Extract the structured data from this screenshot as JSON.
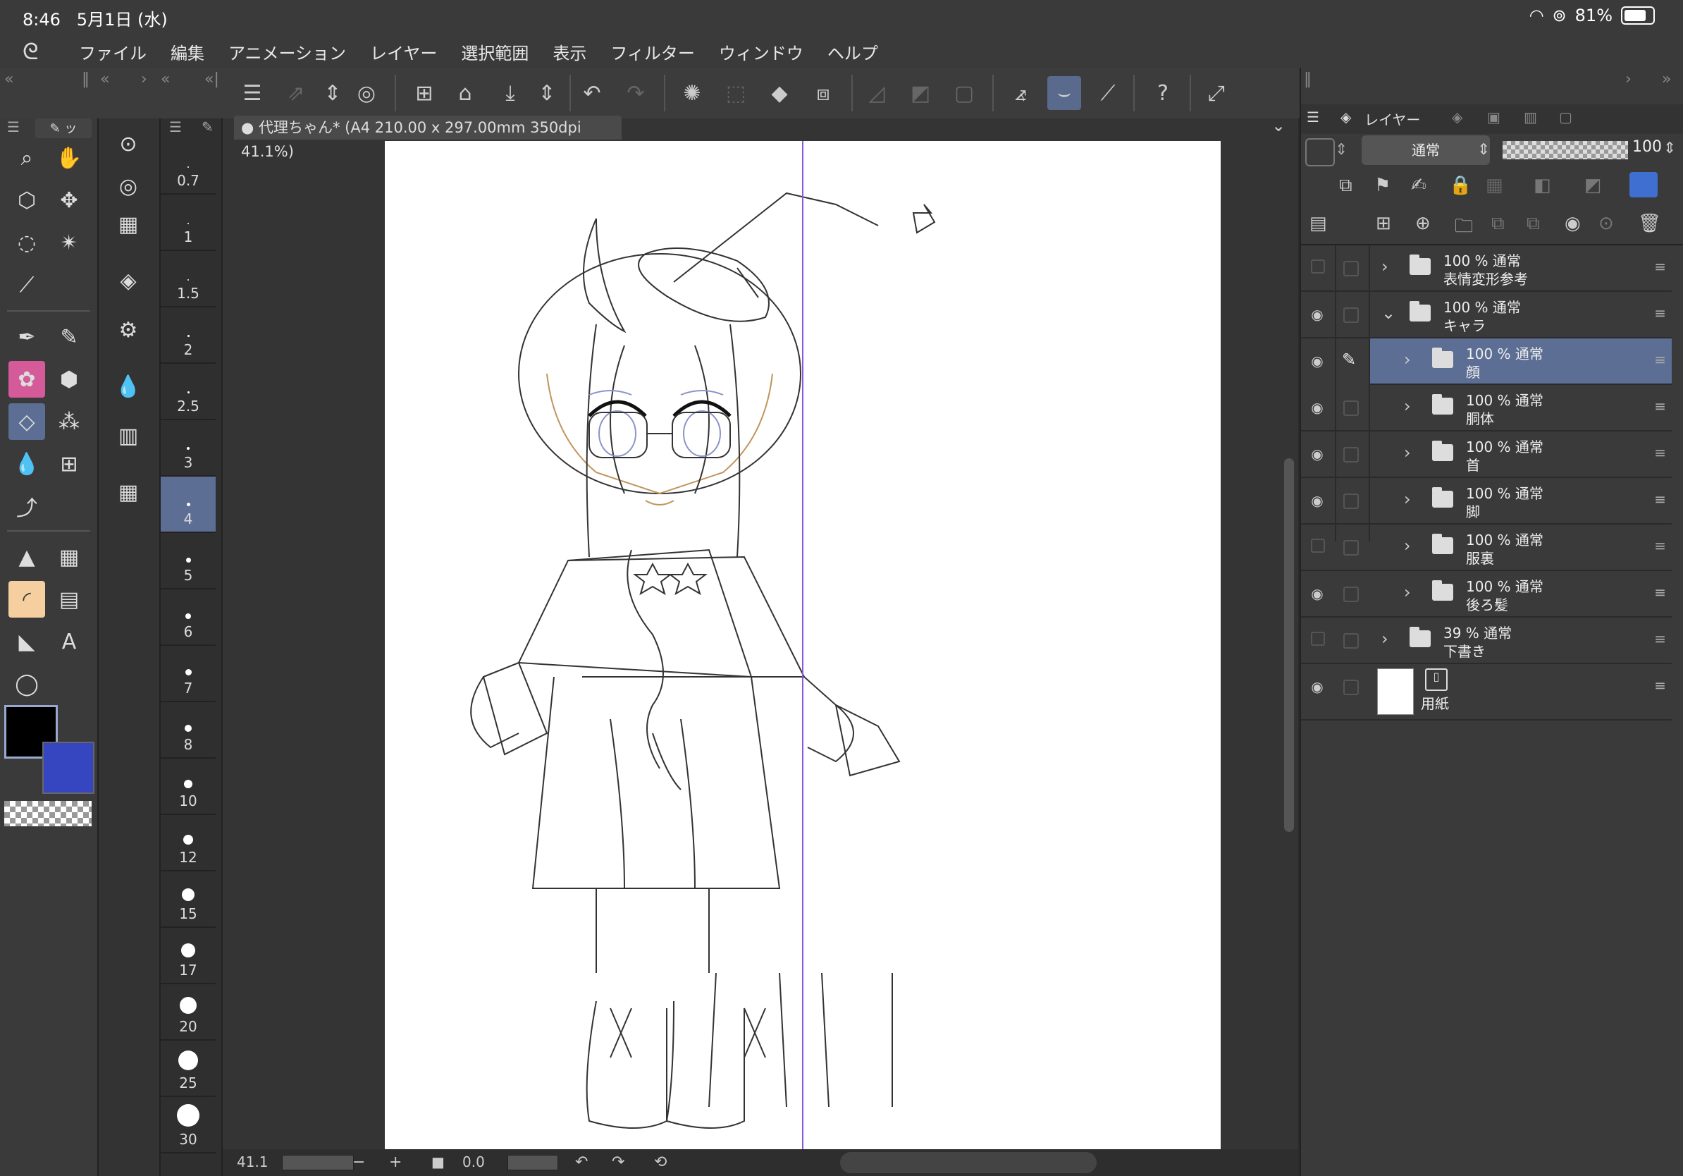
{
  "status": {
    "time": "8:46",
    "date": "5月1日 (水)",
    "battery": "81%"
  },
  "menu": [
    "ファイル",
    "編集",
    "アニメーション",
    "レイヤー",
    "選択範囲",
    "表示",
    "フィルター",
    "ウィンドウ",
    "ヘルプ"
  ],
  "document": {
    "tab_title": "● 代理ちゃん* (A4 210.00 x 297.00mm 350dpi 41.1%)"
  },
  "brush_sizes": [
    "0.7",
    "1",
    "1.5",
    "2",
    "2.5",
    "3",
    "4",
    "5",
    "6",
    "7",
    "8",
    "10",
    "12",
    "15",
    "17",
    "20",
    "25",
    "30"
  ],
  "selected_brush_size": "4",
  "colors": {
    "main": "#000000",
    "sub": "#3546c0",
    "accent": "#5c6e93",
    "guide": "#8a5bd6"
  },
  "bottom": {
    "zoom": "41.1",
    "rotation": "0.0"
  },
  "layer_panel": {
    "tab_label": "レイヤー",
    "blend_mode": "通常",
    "opacity": "100"
  },
  "layers": [
    {
      "pct": "100 % 通常",
      "name": "表情変形参考",
      "visible": false,
      "indent": 0,
      "expanded": false,
      "selected": false,
      "type": "folder"
    },
    {
      "pct": "100 % 通常",
      "name": "キャラ",
      "visible": true,
      "indent": 0,
      "expanded": true,
      "selected": false,
      "type": "folder"
    },
    {
      "pct": "100 % 通常",
      "name": "顔",
      "visible": true,
      "indent": 1,
      "expanded": false,
      "selected": true,
      "type": "folder"
    },
    {
      "pct": "100 % 通常",
      "name": "胴体",
      "visible": true,
      "indent": 1,
      "expanded": false,
      "selected": false,
      "type": "folder"
    },
    {
      "pct": "100 % 通常",
      "name": "首",
      "visible": true,
      "indent": 1,
      "expanded": false,
      "selected": false,
      "type": "folder"
    },
    {
      "pct": "100 % 通常",
      "name": "脚",
      "visible": true,
      "indent": 1,
      "expanded": false,
      "selected": false,
      "type": "folder"
    },
    {
      "pct": "100 % 通常",
      "name": "服裏",
      "visible": false,
      "indent": 1,
      "expanded": false,
      "selected": false,
      "type": "folder"
    },
    {
      "pct": "100 % 通常",
      "name": "後ろ髪",
      "visible": true,
      "indent": 1,
      "expanded": false,
      "selected": false,
      "type": "folder"
    },
    {
      "pct": "39 % 通常",
      "name": "下書き",
      "visible": false,
      "indent": 0,
      "expanded": false,
      "selected": false,
      "type": "folder"
    },
    {
      "pct": "",
      "name": "用紙",
      "visible": true,
      "indent": 0,
      "expanded": false,
      "selected": false,
      "type": "paper"
    }
  ]
}
